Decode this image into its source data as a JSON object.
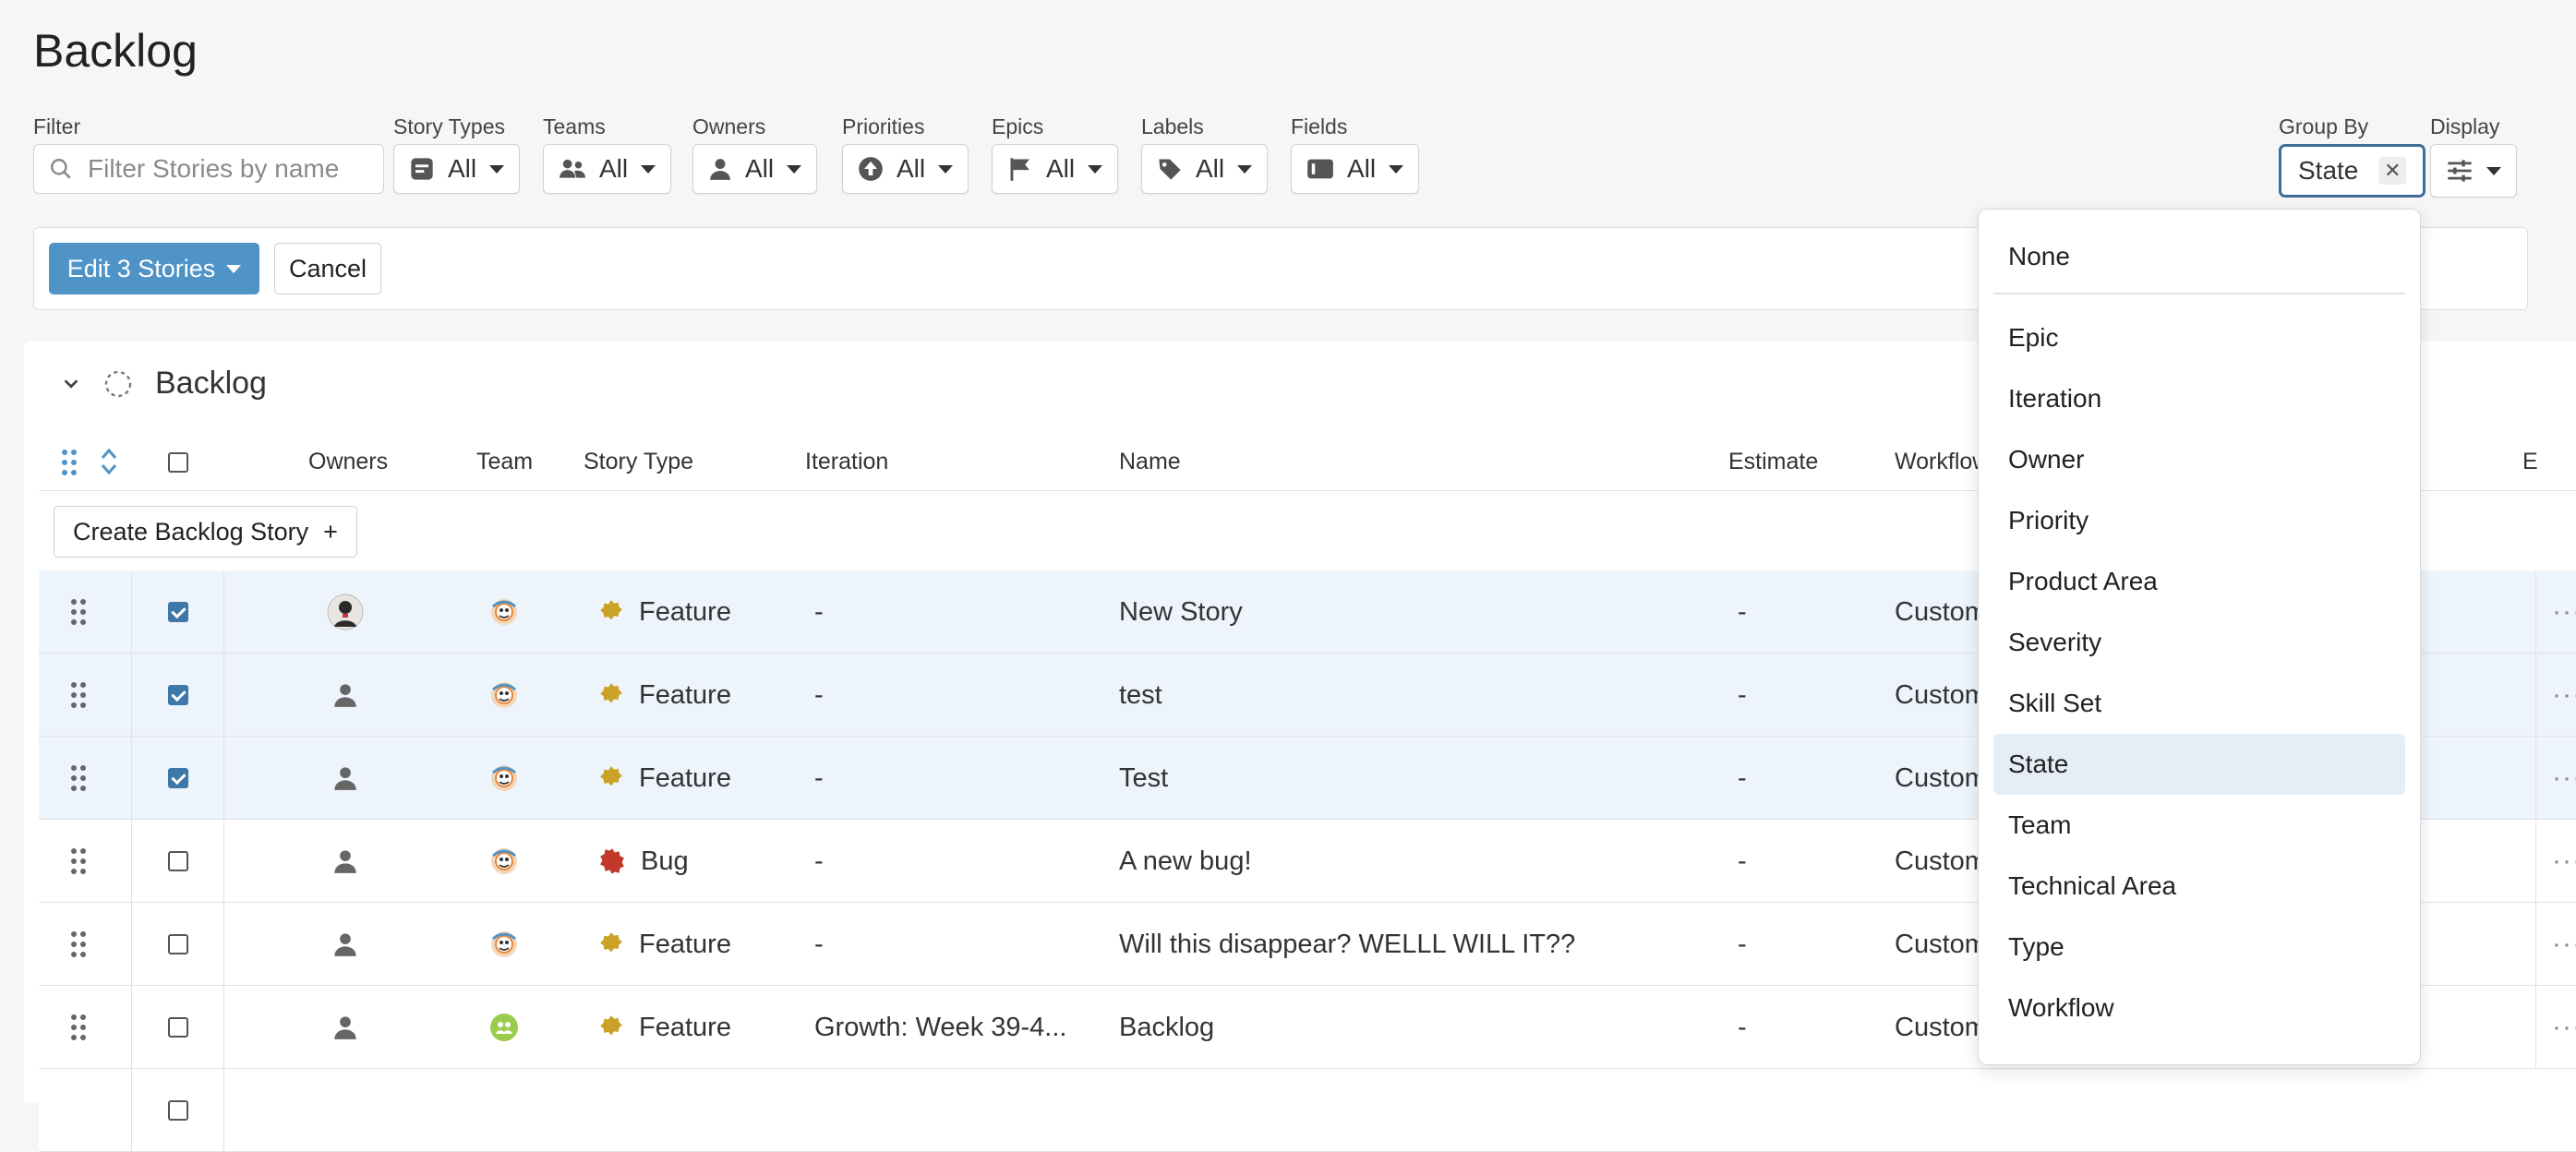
{
  "page": {
    "title": "Backlog"
  },
  "filters": {
    "filter_label": "Filter",
    "search_placeholder": "Filter Stories by name",
    "story_types": {
      "label": "Story Types",
      "value": "All"
    },
    "teams": {
      "label": "Teams",
      "value": "All"
    },
    "owners": {
      "label": "Owners",
      "value": "All"
    },
    "priorities": {
      "label": "Priorities",
      "value": "All"
    },
    "epics": {
      "label": "Epics",
      "value": "All"
    },
    "labels": {
      "label": "Labels",
      "value": "All"
    },
    "fields": {
      "label": "Fields",
      "value": "All"
    },
    "group_by": {
      "label": "Group By",
      "value": "State"
    },
    "display": {
      "label": "Display"
    }
  },
  "editbar": {
    "edit_label": "Edit 3 Stories",
    "cancel_label": "Cancel"
  },
  "group": {
    "title": "Backlog"
  },
  "columns": {
    "owners": "Owners",
    "team": "Team",
    "story_type": "Story Type",
    "iteration": "Iteration",
    "name": "Name",
    "estimate": "Estimate",
    "workflow": "Workflow",
    "extra": "E"
  },
  "create_label": "Create Backlog Story",
  "rows": [
    {
      "selected": true,
      "owner": "photo",
      "team": "team-a",
      "type": "Feature",
      "type_icon": "feature-icon",
      "iteration": "-",
      "name": "New Story",
      "estimate": "-",
      "workflow": "Customer"
    },
    {
      "selected": true,
      "owner": "person",
      "team": "team-a",
      "type": "Feature",
      "type_icon": "feature-icon",
      "iteration": "-",
      "name": "test",
      "estimate": "-",
      "workflow": "Customer"
    },
    {
      "selected": true,
      "owner": "person",
      "team": "team-a",
      "type": "Feature",
      "type_icon": "feature-icon",
      "iteration": "-",
      "name": "Test",
      "estimate": "-",
      "workflow": "Customer"
    },
    {
      "selected": false,
      "owner": "person",
      "team": "team-a",
      "type": "Bug",
      "type_icon": "bug-icon",
      "iteration": "-",
      "name": "A new bug!",
      "estimate": "-",
      "workflow": "Customer"
    },
    {
      "selected": false,
      "owner": "person",
      "team": "team-a",
      "type": "Feature",
      "type_icon": "feature-icon",
      "iteration": "-",
      "name": "Will this disappear? WELLL WILL IT??",
      "estimate": "-",
      "workflow": "Customer"
    },
    {
      "selected": false,
      "owner": "person",
      "team": "team-b",
      "type": "Feature",
      "type_icon": "feature-icon",
      "iteration": "Growth: Week 39-4...",
      "name": "Backlog",
      "estimate": "-",
      "workflow": "Customer"
    }
  ],
  "group_by_menu": {
    "none": "None",
    "items": [
      "Epic",
      "Iteration",
      "Owner",
      "Priority",
      "Product Area",
      "Severity",
      "Skill Set",
      "State",
      "Team",
      "Technical Area",
      "Type",
      "Workflow"
    ],
    "selected": "State"
  },
  "colors": {
    "accent": "#4f93c7",
    "selected_row": "#eef4fb",
    "focus_border": "#3d6c95",
    "feature": "#c9a227",
    "bug": "#c0392b"
  }
}
